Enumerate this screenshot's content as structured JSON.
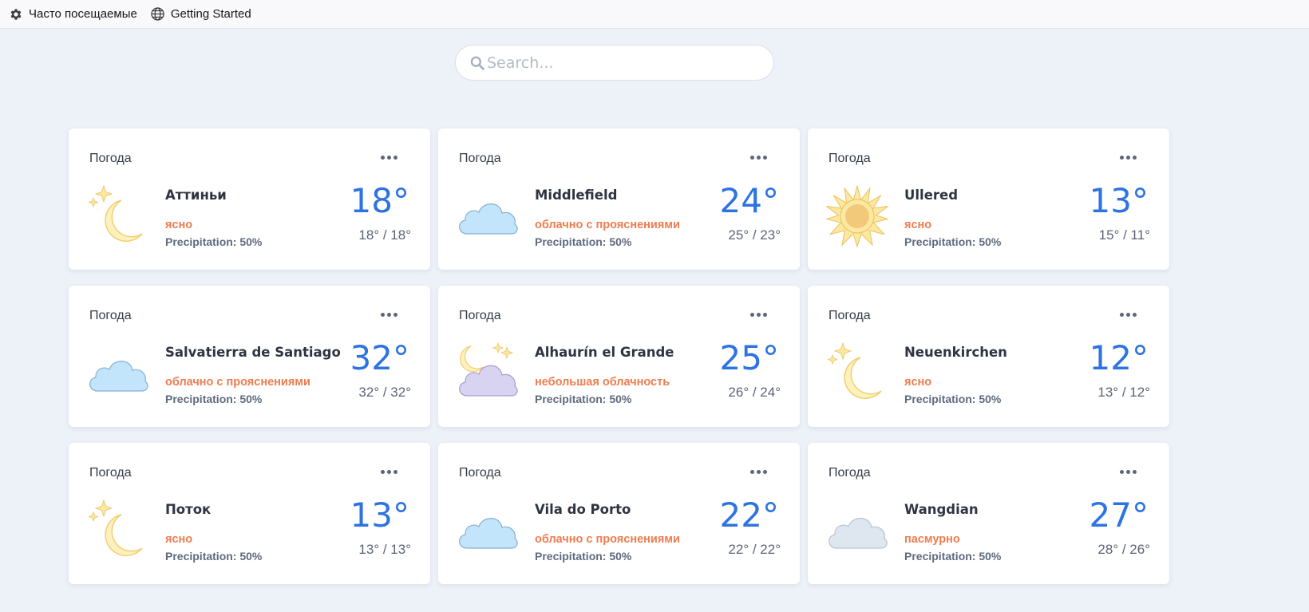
{
  "bookmarks": [
    {
      "label": "Часто посещаемые",
      "icon": "gear-icon"
    },
    {
      "label": "Getting Started",
      "icon": "globe-icon"
    }
  ],
  "search": {
    "placeholder": "Search..."
  },
  "cards": [
    {
      "title": "Погода",
      "city": "Аттиньи",
      "condition": "ясно",
      "precipitation": "Precipitation: 50%",
      "temp": "18°",
      "range": "18° / 18°",
      "icon": "moon-icon"
    },
    {
      "title": "Погода",
      "city": "Middlefield",
      "condition": "облачно с прояснениями",
      "precipitation": "Precipitation: 50%",
      "temp": "24°",
      "range": "25° / 23°",
      "icon": "cloud-icon"
    },
    {
      "title": "Погода",
      "city": "Ullered",
      "condition": "ясно",
      "precipitation": "Precipitation: 50%",
      "temp": "13°",
      "range": "15° / 11°",
      "icon": "sun-icon"
    },
    {
      "title": "Погода",
      "city": "Salvatierra de Santiago",
      "condition": "облачно с прояснениями",
      "precipitation": "Precipitation: 50%",
      "temp": "32°",
      "range": "32° / 32°",
      "icon": "cloud-icon"
    },
    {
      "title": "Погода",
      "city": "Alhaurín el Grande",
      "condition": "небольшая облачность",
      "precipitation": "Precipitation: 50%",
      "temp": "25°",
      "range": "26° / 24°",
      "icon": "moon-cloud-icon"
    },
    {
      "title": "Погода",
      "city": "Neuenkirchen",
      "condition": "ясно",
      "precipitation": "Precipitation: 50%",
      "temp": "12°",
      "range": "13° / 12°",
      "icon": "moon-icon"
    },
    {
      "title": "Погода",
      "city": "Поток",
      "condition": "ясно",
      "precipitation": "Precipitation: 50%",
      "temp": "13°",
      "range": "13° / 13°",
      "icon": "moon-icon"
    },
    {
      "title": "Погода",
      "city": "Vila do Porto",
      "condition": "облачно с прояснениями",
      "precipitation": "Precipitation: 50%",
      "temp": "22°",
      "range": "22° / 22°",
      "icon": "cloud-icon"
    },
    {
      "title": "Погода",
      "city": "Wangdian",
      "condition": "пасмурно",
      "precipitation": "Precipitation: 50%",
      "temp": "27°",
      "range": "28° / 26°",
      "icon": "overcast-cloud-icon"
    }
  ],
  "colors": {
    "accent": "#2d73e1",
    "condition": "#ef7c4e",
    "background": "#edf1f8"
  }
}
